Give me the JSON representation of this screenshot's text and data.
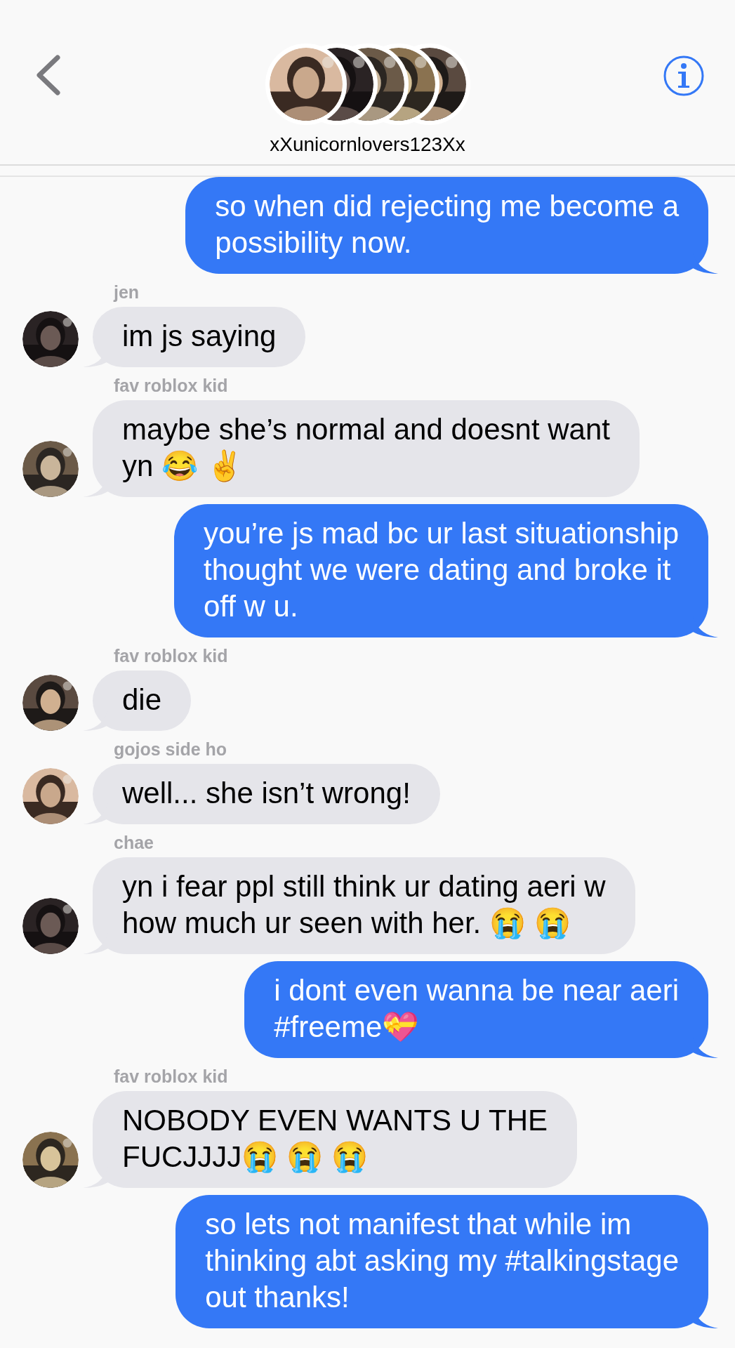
{
  "header": {
    "title": "xXunicornlovers123Xx"
  },
  "messages": [
    {
      "kind": "sent",
      "text": "so when did rejecting me become a\npossibility now."
    },
    {
      "kind": "received",
      "sender": "jen",
      "text": "im js saying"
    },
    {
      "kind": "received",
      "sender": "fav roblox kid",
      "text": "maybe she’s normal and doesnt want\nyn 😂 ✌️"
    },
    {
      "kind": "sent",
      "text": "you’re js mad bc ur last situationship\nthought we were dating and broke it\noff w u."
    },
    {
      "kind": "received",
      "sender": "fav roblox kid",
      "text": "die"
    },
    {
      "kind": "received",
      "sender": "gojos side ho",
      "text": "well... she isn’t wrong!"
    },
    {
      "kind": "received",
      "sender": "chae",
      "text": "yn i fear ppl still think ur dating aeri w\nhow much ur seen with her. 😭 😭"
    },
    {
      "kind": "sent",
      "text": "i dont even wanna be near aeri\n#freeme💝"
    },
    {
      "kind": "received",
      "sender": "fav roblox kid",
      "text": "NOBODY EVEN WANTS U THE\nFUCJJJJ😭 😭 😭"
    },
    {
      "kind": "sent",
      "text": "so lets not manifest that while im\nthinking abt asking my #talkingstage\nout thanks!"
    }
  ]
}
